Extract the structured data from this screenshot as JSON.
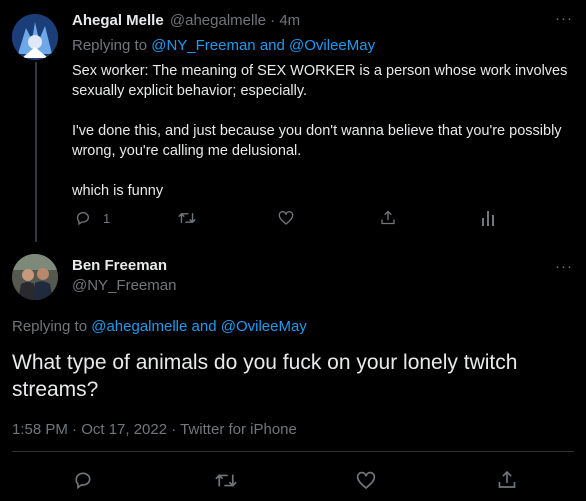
{
  "reply_tweet": {
    "display_name": "Ahegal Melle",
    "handle": "@ahegalmelle",
    "separator": "·",
    "time_ago": "4m",
    "replying_prefix": "Replying to",
    "replying_users": "@NY_Freeman and @OvileeMay",
    "paragraphs": [
      "Sex worker: The meaning of SEX WORKER is a person whose work involves sexually explicit behavior; especially.",
      "I've done this, and just because you don't wanna believe that you're possibly wrong, you're calling me delusional.",
      "which is funny"
    ],
    "reply_count": "1",
    "icons": [
      "reply-icon",
      "retweet-icon",
      "like-icon",
      "share-icon",
      "analytics-icon"
    ]
  },
  "main_tweet": {
    "display_name": "Ben Freeman",
    "handle": "@NY_Freeman",
    "replying_prefix": "Replying to",
    "replying_user_1": "@ahegalmelle",
    "replying_and": "and",
    "replying_user_2": "@OvileeMay",
    "text": "What type of animals do you fuck on your lonely twitch streams?",
    "timestamp": "1:58 PM · Oct 17, 2022 · Twitter for iPhone",
    "icons": [
      "reply-icon",
      "retweet-icon",
      "like-icon",
      "share-icon"
    ]
  },
  "colors": {
    "background": "#000000",
    "text": "#e7e9ea",
    "muted": "#71767b",
    "accent": "#1d9bf0"
  }
}
